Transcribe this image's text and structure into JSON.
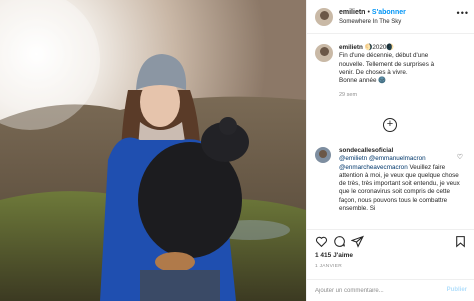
{
  "header": {
    "username": "emilietn",
    "separator": "•",
    "follow_label": "S'abonner",
    "location": "Somewhere In The Sky",
    "more_label": "•••"
  },
  "caption": {
    "username": "emilietn",
    "badge": "🌖2020🌒",
    "lines": [
      "Fin d'une décennie, début d'une",
      "nouvelle. Tellement de surprises à",
      "venir. De choses à vivre.",
      "Bonne année 🌚"
    ],
    "time": "29 sem"
  },
  "comment": {
    "username": "sondecallesoficial",
    "mention1": "@emilietn",
    "mention2": "@emmanuelmacron",
    "mention3": "@enmarcheavecmacron",
    "text_after": "Veuillez faire attention à moi, je veux que quelque chose de très, très important soit entendu, je veux que le coronavirus soit compris de cette façon, nous pouvons tous le combattre ensemble. Si"
  },
  "actions": {
    "likes": "1 415 J'aime",
    "date": "1 JANVIER"
  },
  "add_comment": {
    "placeholder": "Ajouter un commentaire...",
    "publish_label": "Publier"
  },
  "colors": {
    "accent": "#0095f6",
    "mention": "#00376b",
    "muted": "#8e8e8e",
    "border": "#efefef"
  }
}
